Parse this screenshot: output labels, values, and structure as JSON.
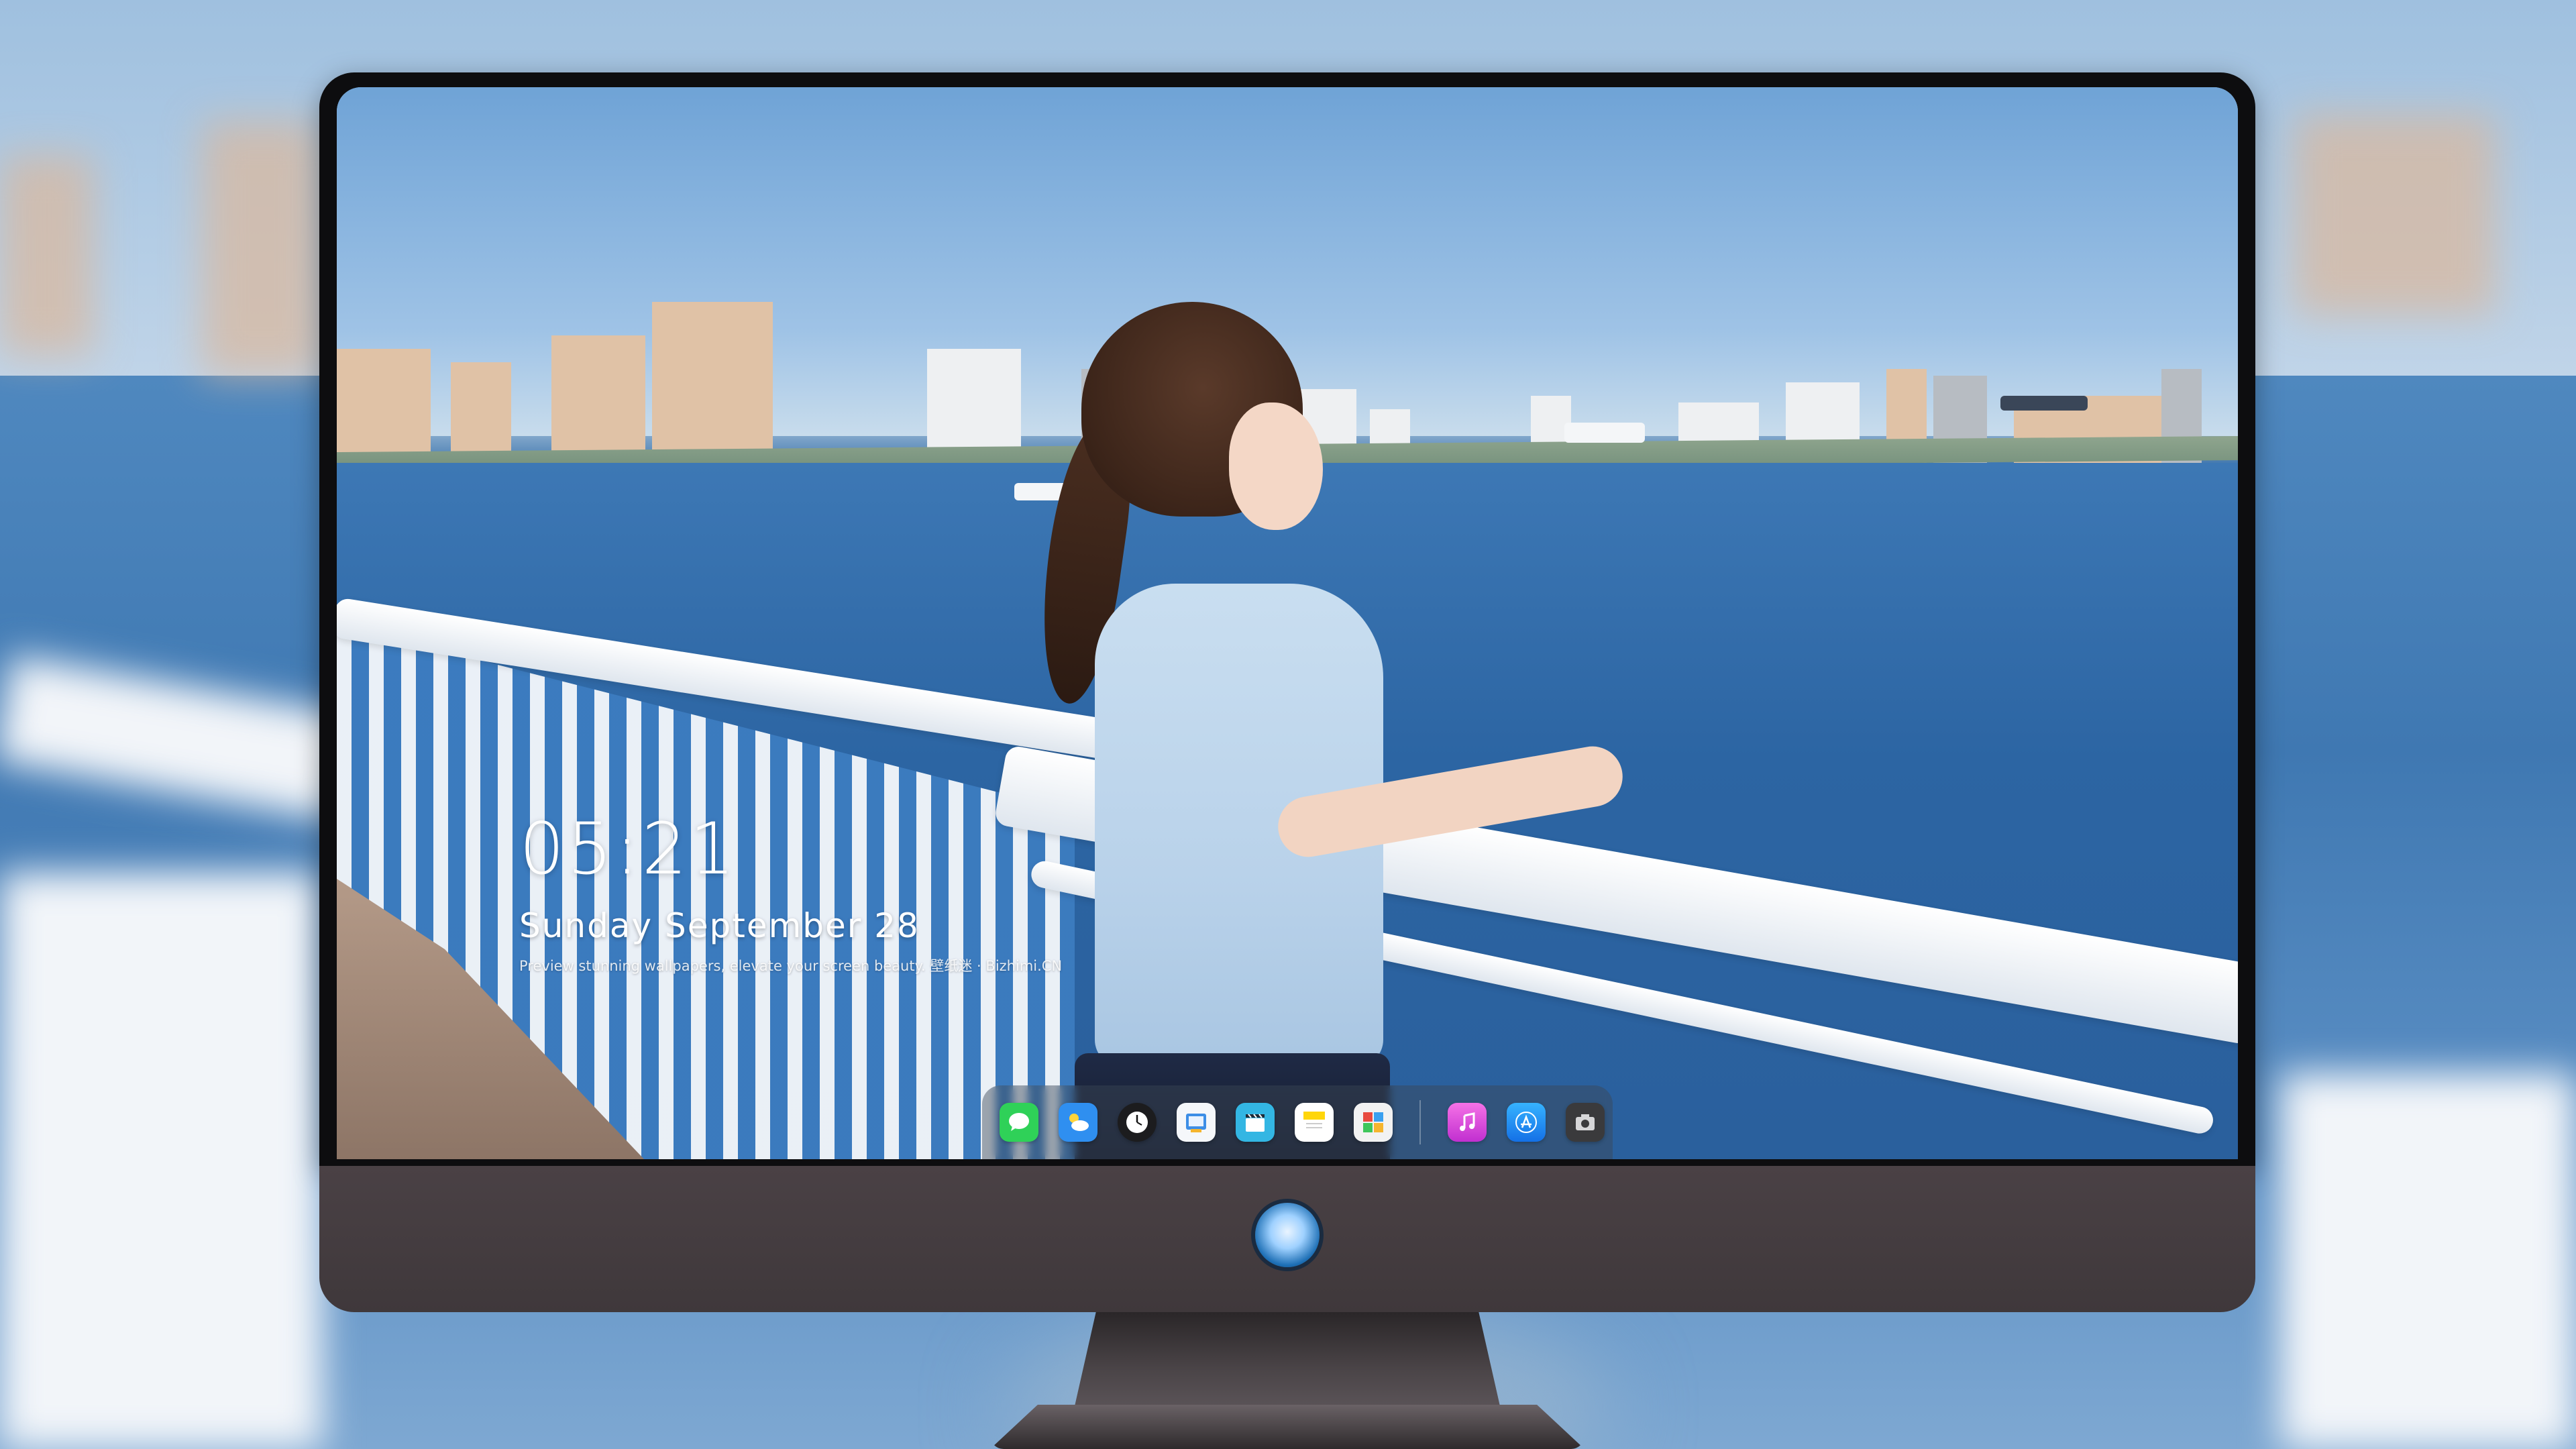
{
  "lockscreen": {
    "time": "05:21",
    "date": "Sunday September 28",
    "caption": "Preview stunning wallpapers, elevate your screen beauty. 壁纸迷 · Bizhimi.CN"
  },
  "dock": {
    "items": [
      {
        "name": "messages-app",
        "icon": "message-bubble-icon",
        "color": "#2fd158"
      },
      {
        "name": "weather-app",
        "icon": "cloud-sun-icon",
        "color": "#2f8ff0"
      },
      {
        "name": "clock-app",
        "icon": "clock-icon",
        "color": "#1c1c1e"
      },
      {
        "name": "preview-app",
        "icon": "photo-viewer-icon",
        "color": "#3d8ee6"
      },
      {
        "name": "video-app",
        "icon": "clapperboard-icon",
        "color": "#33b6e3"
      },
      {
        "name": "notes-app",
        "icon": "notes-icon",
        "color": "#ffd60a"
      },
      {
        "name": "photos-collage-app",
        "icon": "collage-icon",
        "color": "#f2f2f2"
      },
      {
        "name": "music-app",
        "icon": "music-note-icon",
        "color": "#e94fd6"
      },
      {
        "name": "app-store",
        "icon": "app-store-icon",
        "color": "#1b8cf6"
      },
      {
        "name": "camera-app",
        "icon": "camera-icon",
        "color": "#3a3a3c"
      }
    ]
  },
  "colors": {
    "bezel": "#0d0d0f",
    "chin": "#433b3f",
    "clock_text": "#ffffff",
    "sea": "#2c65a3"
  }
}
